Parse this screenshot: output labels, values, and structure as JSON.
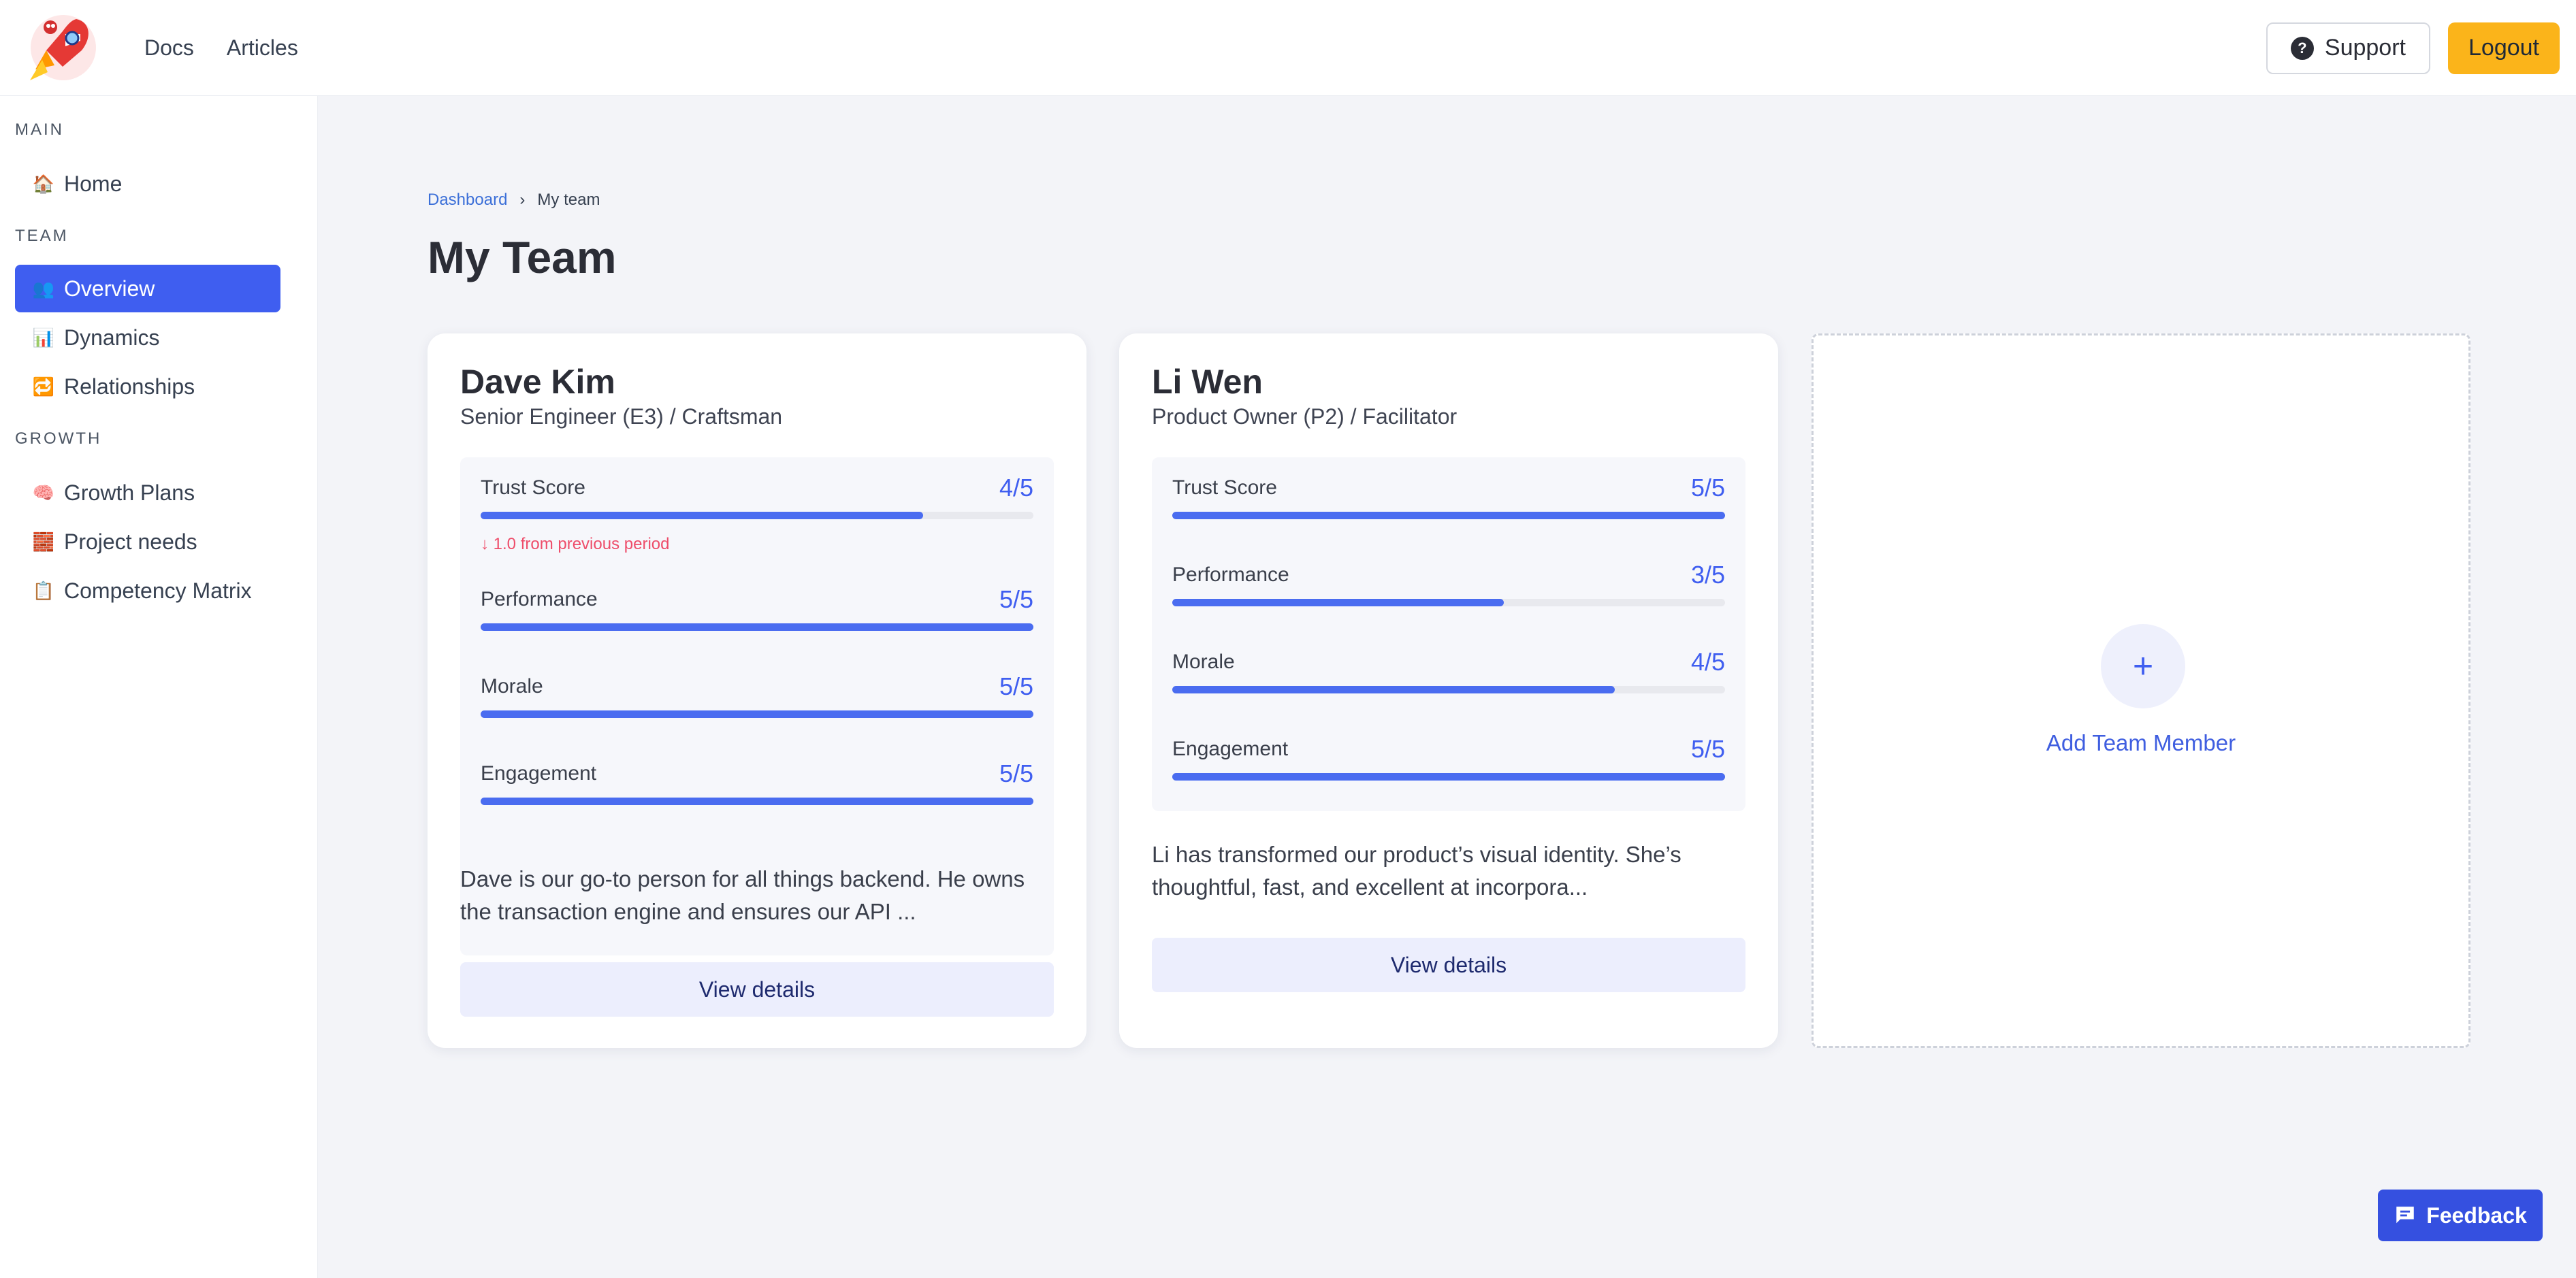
{
  "topnav": {
    "items": [
      "Docs",
      "Articles"
    ]
  },
  "topright": {
    "support_label": "Support",
    "logout_label": "Logout"
  },
  "sidebar": {
    "sections": [
      {
        "title": "MAIN",
        "items": [
          {
            "label": "Home",
            "icon": "house-icon"
          }
        ]
      },
      {
        "title": "TEAM",
        "items": [
          {
            "label": "Overview",
            "icon": "people-icon",
            "active": true
          },
          {
            "label": "Dynamics",
            "icon": "bar-chart-icon"
          },
          {
            "label": "Relationships",
            "icon": "repeat-icon"
          }
        ]
      },
      {
        "title": "GROWTH",
        "items": [
          {
            "label": "Growth Plans",
            "icon": "brain-icon"
          },
          {
            "label": "Project needs",
            "icon": "brick-icon"
          },
          {
            "label": "Competency Matrix",
            "icon": "clipboard-icon"
          }
        ]
      }
    ]
  },
  "breadcrumb": {
    "parent": "Dashboard",
    "separator": "›",
    "current": "My team"
  },
  "page": {
    "title": "My Team"
  },
  "members": [
    {
      "name": "Dave Kim",
      "role": "Senior Engineer (E3) / Craftsman",
      "metrics": [
        {
          "label": "Trust Score",
          "value": "4/5",
          "fraction": 0.8,
          "delta": "↓ 1.0 from previous period"
        },
        {
          "label": "Performance",
          "value": "5/5",
          "fraction": 1.0
        },
        {
          "label": "Morale",
          "value": "5/5",
          "fraction": 1.0
        },
        {
          "label": "Engagement",
          "value": "5/5",
          "fraction": 1.0
        }
      ],
      "description": "Dave is our go-to person for all things backend. He owns the transaction engine and ensures our API ...",
      "button_label": "View details"
    },
    {
      "name": "Li Wen",
      "role": "Product Owner (P2) / Facilitator",
      "metrics": [
        {
          "label": "Trust Score",
          "value": "5/5",
          "fraction": 1.0
        },
        {
          "label": "Performance",
          "value": "3/5",
          "fraction": 0.6
        },
        {
          "label": "Morale",
          "value": "4/5",
          "fraction": 0.8
        },
        {
          "label": "Engagement",
          "value": "5/5",
          "fraction": 1.0
        }
      ],
      "description": "Li has transformed our product’s visual identity. She’s thoughtful, fast, and excellent at incorpora...",
      "button_label": "View details"
    }
  ],
  "add_member": {
    "icon_text": "+",
    "label": "Add Team Member"
  },
  "feedback": {
    "label": "Feedback"
  },
  "colors": {
    "accent": "#3f5ef0",
    "logout_bg": "#fbb41a",
    "feedback_bg": "#3550e0",
    "delta_red": "#ee4d6a"
  }
}
